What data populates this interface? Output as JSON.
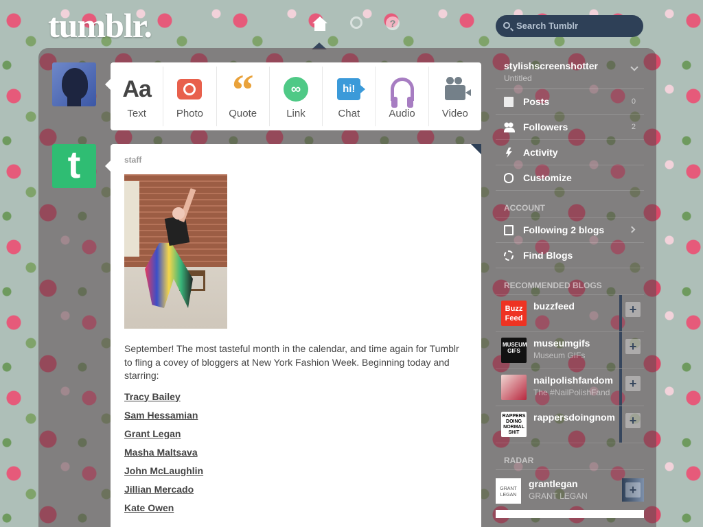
{
  "header": {
    "logo": "tumblr.",
    "search_placeholder": "Search Tumblr",
    "help_glyph": "?"
  },
  "composer": {
    "types": [
      {
        "label": "Text",
        "icon": "text-icon",
        "glyph": "Aa"
      },
      {
        "label": "Photo",
        "icon": "camera-icon",
        "glyph": ""
      },
      {
        "label": "Quote",
        "icon": "quote-icon",
        "glyph": "“"
      },
      {
        "label": "Link",
        "icon": "link-icon",
        "glyph": "∞"
      },
      {
        "label": "Chat",
        "icon": "chat-icon",
        "glyph": "hi!"
      },
      {
        "label": "Audio",
        "icon": "headphones-icon",
        "glyph": ""
      },
      {
        "label": "Video",
        "icon": "video-camera-icon",
        "glyph": ""
      }
    ]
  },
  "post": {
    "author": "staff",
    "avatar_letter": "t",
    "text": "September! The most tasteful month in the calendar, and time again for Tumblr to fling a covey of bloggers at New York Fashion Week. Beginning today and starring:",
    "links": [
      "Tracy Bailey",
      "Sam Hessamian",
      "Grant Legan",
      "Masha Maltsava",
      "John McLaughlin",
      "Jillian Mercado",
      "Kate Owen"
    ]
  },
  "sidebar": {
    "blog_name": "stylishscreenshotter",
    "blog_title": "Untitled",
    "items": [
      {
        "label": "Posts",
        "count": "0"
      },
      {
        "label": "Followers",
        "count": "2"
      },
      {
        "label": "Activity",
        "count": ""
      },
      {
        "label": "Customize",
        "count": ""
      }
    ],
    "account_header": "ACCOUNT",
    "account_items": [
      {
        "label": "Following 2 blogs"
      },
      {
        "label": "Find Blogs"
      }
    ],
    "recommended_header": "RECOMMENDED BLOGS",
    "recommended": [
      {
        "name": "buzzfeed",
        "sub": "",
        "thumb_text": "Buzz Feed"
      },
      {
        "name": "museumgifs",
        "sub": "Museum GIFs",
        "thumb_text": "MUSEUM GIFS"
      },
      {
        "name": "nailpolishfandom",
        "sub": "The #NailPolishFand",
        "thumb_text": ""
      },
      {
        "name": "rappersdoingnom",
        "sub": "",
        "thumb_text": "RAPPERS DOING NORMAL SHIT"
      }
    ],
    "radar_header": "RADAR",
    "radar": {
      "name": "grantlegan",
      "sub": "GRANT LEGAN",
      "thumb_text": "GRANT LEGAN"
    },
    "follow_glyph": "+"
  }
}
